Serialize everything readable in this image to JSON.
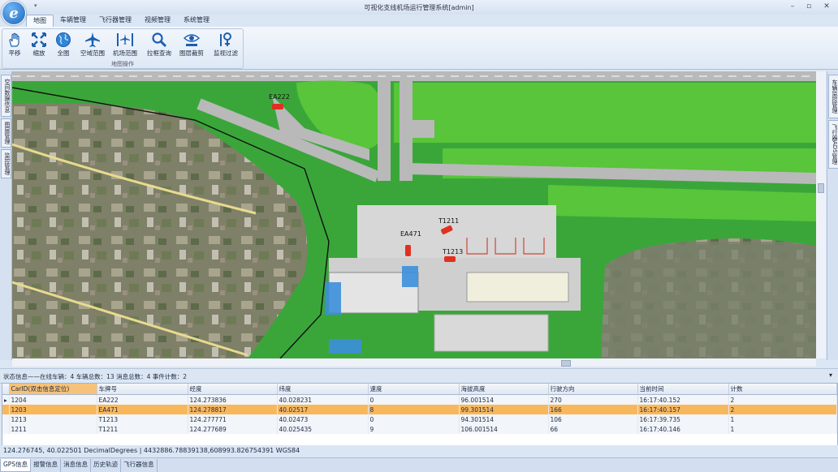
{
  "window": {
    "title": "可视化支线机场运行管理系统[admin]"
  },
  "menu_tabs": [
    "地图",
    "车辆管理",
    "飞行器管理",
    "视频管理",
    "系统管理"
  ],
  "ribbon": {
    "buttons": [
      "平移",
      "缩放",
      "全图",
      "空域范围",
      "机场范围",
      "拉框查询",
      "图层裁剪",
      "监视过滤"
    ],
    "group_label": "地图操作"
  },
  "left_side_tabs": [
    "空间数据信息",
    "图层管理",
    "监控管理"
  ],
  "right_side_tabs": [
    "车辆监控管理",
    "飞行器ADS管理"
  ],
  "map": {
    "labels": [
      "EA222",
      "T1211",
      "EA471",
      "T1213"
    ]
  },
  "status": {
    "text": "状态信息——在线车辆：4  车辆总数：13  消息总数：4  事件计数：2"
  },
  "grid": {
    "columns": [
      "CarID(双击信息定位)",
      "车牌号",
      "经度",
      "纬度",
      "速度",
      "海拔高度",
      "行驶方向",
      "当前时间",
      "计数"
    ],
    "rows": [
      [
        "1204",
        "EA222",
        "124.273836",
        "40.028231",
        "0",
        "96.001514",
        "270",
        "16:17:40.152",
        "2"
      ],
      [
        "1203",
        "EA471",
        "124.278817",
        "40.02517",
        "8",
        "99.301514",
        "166",
        "16:17:40.157",
        "2"
      ],
      [
        "1213",
        "T1213",
        "124.277771",
        "40.02473",
        "0",
        "94.301514",
        "106",
        "16:17:39.735",
        "1"
      ],
      [
        "1211",
        "T1211",
        "124.277689",
        "40.025435",
        "9",
        "106.001514",
        "66",
        "16:17:40.146",
        "1"
      ]
    ]
  },
  "coords": {
    "text": "124.276745, 40.022501  DecimalDegrees  |  4432886.78839138,608993.826754391  WGS84"
  },
  "bottom_tabs": [
    "GPS信息",
    "报警信息",
    "消息信息",
    "历史轨迹",
    "飞行器信息"
  ],
  "colors": {
    "grass": "#3aa63a",
    "asphalt": "#b9b9b9",
    "vehicle": "#e23020"
  }
}
